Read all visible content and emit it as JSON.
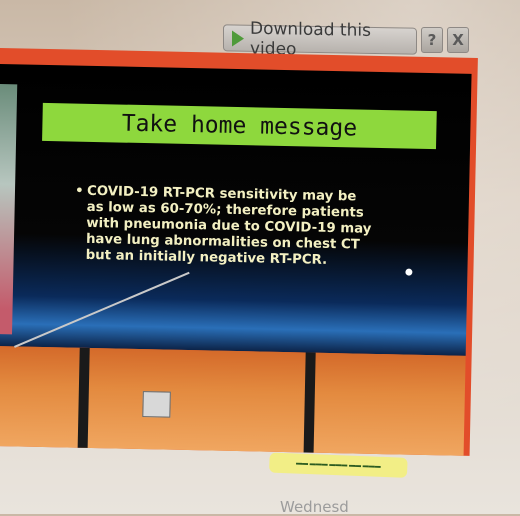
{
  "download_bar": {
    "label": "Download this video",
    "help_label": "?",
    "close_label": "X"
  },
  "slide": {
    "title": "Take home message",
    "bullet": "COVID-19 RT-PCR sensitivity may be as low as 60-70%; therefore patients with pneumonia due to COVID-19 may have lung abnormalities on chest CT but an initially negative RT-PCR."
  },
  "taskbar": {
    "day_partial": "Wednesd"
  },
  "colors": {
    "title_bar": "#8ed83d",
    "slide_text": "#f3f0c2",
    "player_frame": "#e24d2a"
  }
}
